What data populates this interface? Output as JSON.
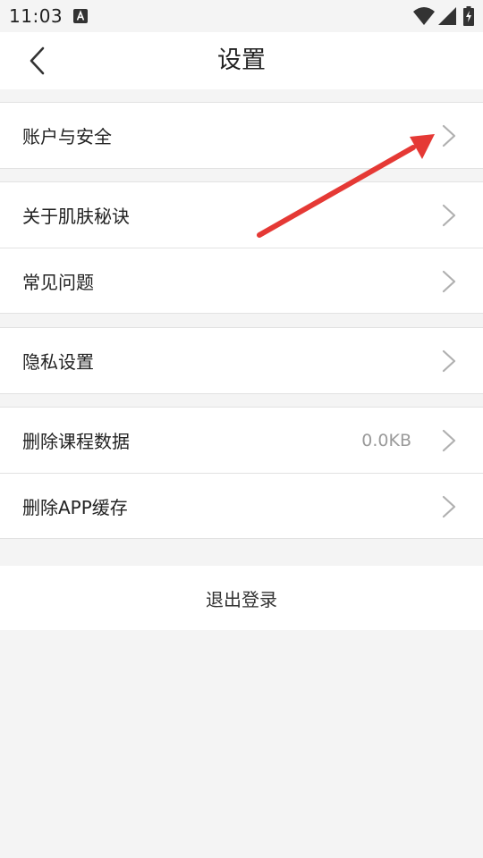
{
  "status_bar": {
    "time": "11:03",
    "icons": [
      "a-notification-icon",
      "wifi-icon",
      "signal-icon",
      "battery-charging-icon"
    ]
  },
  "header": {
    "title": "设置",
    "back_icon": "chevron-left-icon"
  },
  "groups": [
    {
      "items": [
        {
          "label": "账户与安全"
        }
      ]
    },
    {
      "items": [
        {
          "label": "关于肌肤秘诀"
        },
        {
          "label": "常见问题"
        }
      ]
    },
    {
      "items": [
        {
          "label": "隐私设置"
        }
      ]
    },
    {
      "items": [
        {
          "label": "删除课程数据",
          "value": "0.0KB"
        },
        {
          "label": "删除APP缓存"
        }
      ]
    }
  ],
  "logout": {
    "label": "退出登录"
  },
  "colors": {
    "background": "#f4f4f4",
    "card": "#ffffff",
    "divider": "#e2e2e2",
    "chevron": "#b0b0b0",
    "annotation_arrow": "#e53935"
  }
}
